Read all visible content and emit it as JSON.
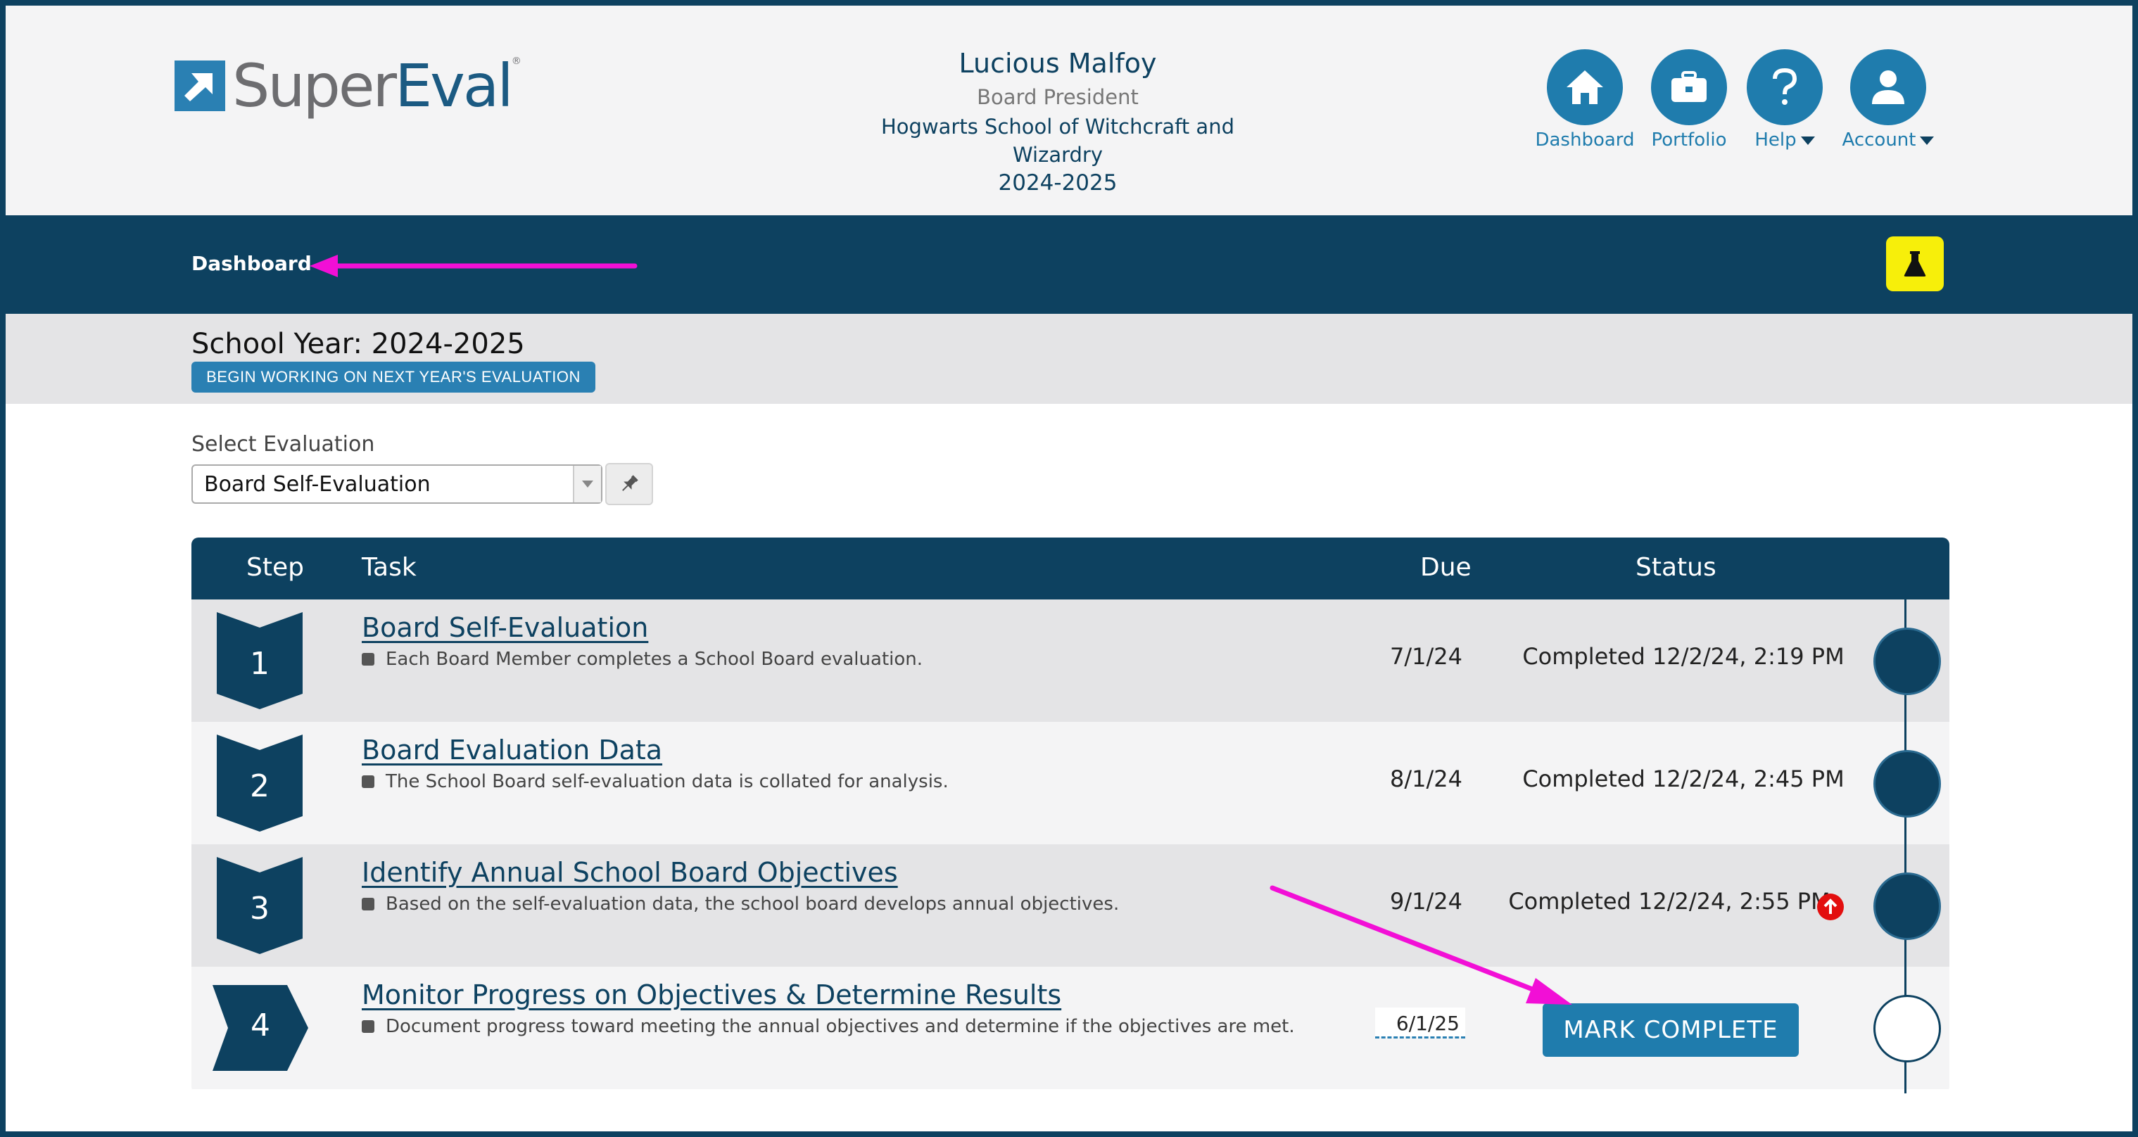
{
  "brand": {
    "name_part1": "Super",
    "name_part2": "Eval",
    "trademark": "®"
  },
  "user": {
    "name": "Lucious Malfoy",
    "role": "Board President",
    "school": "Hogwarts School of Witchcraft and Wizardry",
    "year": "2024-2025"
  },
  "nav": {
    "dashboard": "Dashboard",
    "portfolio": "Portfolio",
    "help": "Help",
    "account": "Account"
  },
  "breadcrumb": "Dashboard",
  "school_year": {
    "label": "School Year: 2024-2025",
    "next_button": "BEGIN WORKING ON NEXT YEAR'S EVALUATION"
  },
  "select": {
    "label": "Select Evaluation",
    "value": "Board Self-Evaluation"
  },
  "table": {
    "headers": {
      "step": "Step",
      "task": "Task",
      "due": "Due",
      "status": "Status"
    },
    "rows": [
      {
        "step": "1",
        "title": "Board Self-Evaluation",
        "desc": "Each Board Member completes a School Board evaluation.",
        "due": "7/1/24",
        "status": "Completed 12/2/24, 2:19 PM"
      },
      {
        "step": "2",
        "title": "Board Evaluation Data",
        "desc": "The School Board self-evaluation data is collated for analysis.",
        "due": "8/1/24",
        "status": "Completed 12/2/24, 2:45 PM"
      },
      {
        "step": "3",
        "title": "Identify Annual School Board Objectives",
        "desc": "Based on the self-evaluation data, the school board develops annual objectives.",
        "due": "9/1/24",
        "status": "Completed 12/2/24, 2:55 PM"
      },
      {
        "step": "4",
        "title": "Monitor Progress on Objectives & Determine Results",
        "desc": "Document progress toward meeting the annual objectives and determine if the objectives are met.",
        "due": "6/1/25",
        "status": "MARK COMPLETE"
      }
    ]
  },
  "colors": {
    "navy": "#0d4160",
    "accent_blue": "#1f7cad",
    "annotation_pink": "#f20fd6",
    "lab_yellow": "#f7ef0a",
    "alert_red": "#e30f0f"
  },
  "icons": {
    "home": "home-icon",
    "portfolio": "briefcase-icon",
    "help": "question-icon",
    "account": "user-icon",
    "lab": "flask-icon",
    "pin": "pin-icon",
    "alert": "arrow-up-circle-icon"
  }
}
